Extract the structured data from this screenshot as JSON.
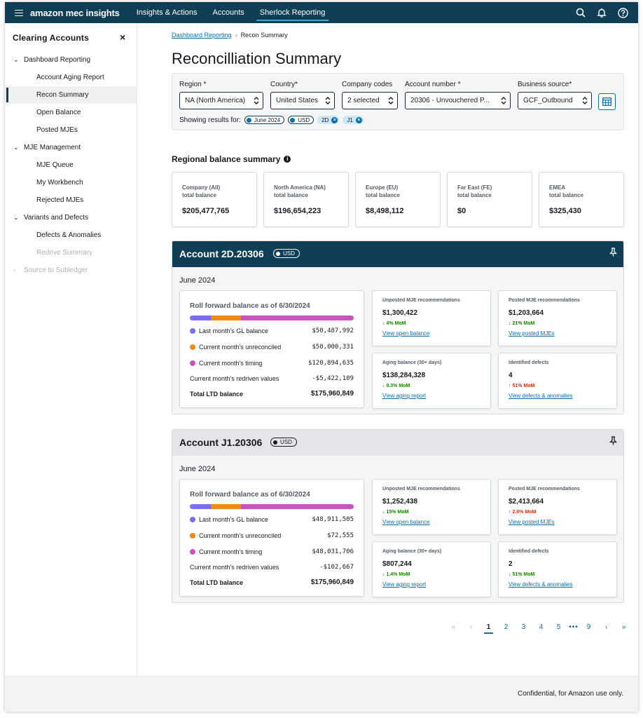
{
  "brand": "amazon mec insights",
  "nav": {
    "links": [
      "Insights & Actions",
      "Accounts",
      "Sherlock Reporting"
    ],
    "active": "Sherlock Reporting"
  },
  "icons": {
    "menu": "hamburger-icon",
    "search": "search-icon",
    "notifications": "bell-icon",
    "help": "help-icon"
  },
  "sidebar": {
    "title": "Clearing Accounts",
    "close": "×",
    "groups": [
      {
        "label": "Dashboard Reporting",
        "items": [
          "Account Aging Report",
          "Recon Summary",
          "Open Balance",
          "Posted MJEs"
        ]
      },
      {
        "label": "MJE Management",
        "items": [
          "MJE Queue",
          "My Workbench",
          "Rejected MJEs"
        ]
      },
      {
        "label": "Variants and Defects",
        "items": [
          "Defects & Anomalies",
          "Redrive Summary"
        ]
      },
      {
        "label": "Source to Subledger",
        "items": []
      }
    ],
    "active_item": "Recon Summary",
    "disabled_items": [
      "Redrive Summary",
      "Source to Subledger"
    ]
  },
  "breadcrumb": {
    "parent": "Dashboard Reporting",
    "current": "Recon Summary"
  },
  "page_title": "Reconcilliation Summary",
  "filters": {
    "region": {
      "label": "Region *",
      "value": "NA (North America)"
    },
    "country": {
      "label": "Country*",
      "value": "United States"
    },
    "company_codes": {
      "label": "Company codes",
      "value": "2 selected"
    },
    "account_number": {
      "label": "Account number *",
      "value": "20306 - Unvouchered P..."
    },
    "business_source": {
      "label": "Business source*",
      "value": "GCF_Outbound"
    },
    "showing_label": "Showing results for:",
    "chips": [
      {
        "label": "June 2024",
        "style": "outline"
      },
      {
        "label": "USD",
        "style": "outline"
      },
      {
        "label": "2D",
        "style": "removable"
      },
      {
        "label": "J1",
        "style": "removable"
      }
    ]
  },
  "regional": {
    "title": "Regional balance summary",
    "cards": [
      {
        "label1": "Company (All)",
        "label2": "total balance",
        "value": "$205,477,765"
      },
      {
        "label1": "North America (NA)",
        "label2": "total balance",
        "value": "$196,654,223"
      },
      {
        "label1": "Europe (EU)",
        "label2": "total balance",
        "value": "$8,498,112"
      },
      {
        "label1": "Far East (FE)",
        "label2": "total balance",
        "value": "$0"
      },
      {
        "label1": "EMEA",
        "label2": "total balance",
        "value": "$325,430"
      }
    ]
  },
  "colors": {
    "gl": "#7b6cf6",
    "unreconciled": "#f28a10",
    "timing": "#c854c0",
    "accent": "#0f3e55",
    "link": "#0b6ea8"
  },
  "accounts": [
    {
      "title": "Account 2D.20306",
      "currency": "USD",
      "month": "June 2024",
      "rollforward": {
        "title": "Roll forward balance as of 6/30/2024",
        "bar": [
          0.13,
          0.18,
          0.69
        ],
        "rows": [
          {
            "label": "Last month's GL balance",
            "value": "$50,487,992"
          },
          {
            "label": "Current month's unreconciled",
            "value": "$50,000,331"
          },
          {
            "label": "Current month's timing",
            "value": "$120,894,635"
          },
          {
            "label": "Current month's redriven values",
            "value": "-$5,422,109"
          }
        ],
        "total_label": "Total LTD balance",
        "total_value": "$175,960,849"
      },
      "metrics": [
        {
          "label": "Unposted MJE recommendations",
          "value": "$1,300,422",
          "change": "↓ 4% MoM",
          "dir": "down",
          "link": "View open balance"
        },
        {
          "label": "Posted MJE recommendations",
          "value": "$1,203,664",
          "change": "↓ 21% MoM",
          "dir": "down",
          "link": "View posted MJEs"
        },
        {
          "label": "Aging balance (30+ days)",
          "value": "$138,284,328",
          "change": "↓ 0.3% MoM",
          "dir": "down",
          "link": "View aging report"
        },
        {
          "label": "Identified defects",
          "value": "4",
          "change": "↑ 51% MoM",
          "dir": "up",
          "link": "View defects & anomalies"
        }
      ]
    },
    {
      "title": "Account J1.20306",
      "currency": "USD",
      "month": "June 2024",
      "rollforward": {
        "title": "Roll forward balance as of 6/30/2024",
        "bar": [
          0.13,
          0.18,
          0.69
        ],
        "rows": [
          {
            "label": "Last month's GL balance",
            "value": "$48,911,505"
          },
          {
            "label": "Current month's unreconciled",
            "value": "$72,555"
          },
          {
            "label": "Current month's timing",
            "value": "$48,031,706"
          },
          {
            "label": "Current month's redriven values",
            "value": "-$102,667"
          }
        ],
        "total_label": "Total LTD balance",
        "total_value": "$175,960,849"
      },
      "metrics": [
        {
          "label": "Unposted MJE recommendations",
          "value": "$1,252,438",
          "change": "↓ 15% MoM",
          "dir": "down",
          "link": "View open balance"
        },
        {
          "label": "Posted MJE recommendations",
          "value": "$2,413,664",
          "change": "↑ 2.6% MoM",
          "dir": "up",
          "link": "View posted MJEs"
        },
        {
          "label": "Aging balance (30+ days)",
          "value": "$807,244",
          "change": "↓ 1.4% MoM",
          "dir": "down",
          "link": "View aging report"
        },
        {
          "label": "Identified defects",
          "value": "2",
          "change": "↓ 51% MoM",
          "dir": "down",
          "link": "View defects & anomalies"
        }
      ]
    }
  ],
  "pagination": {
    "first": "«",
    "prev": "‹",
    "pages": [
      "1",
      "2",
      "3",
      "4",
      "5"
    ],
    "ellipsis": "•••",
    "last_page": "9",
    "next": "›",
    "last": "»",
    "current": "1"
  },
  "footer": "Confidential, for Amazon use only."
}
